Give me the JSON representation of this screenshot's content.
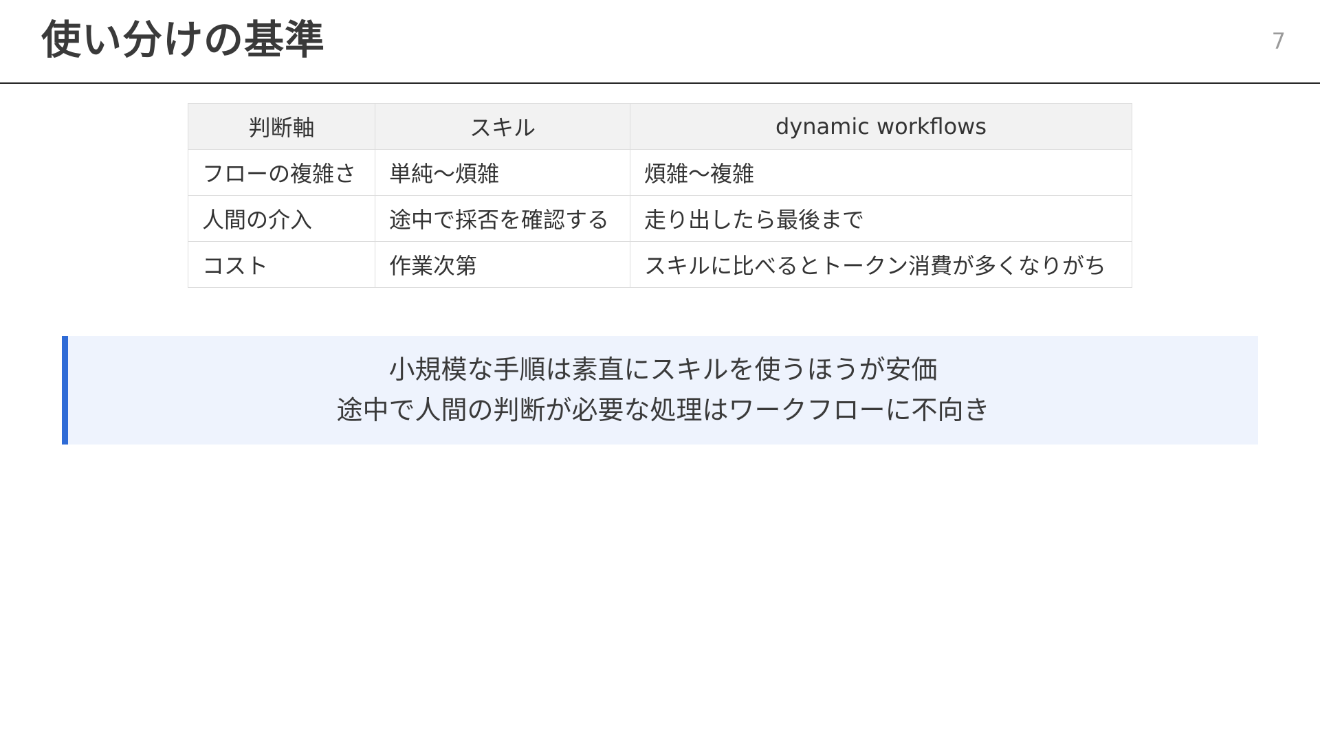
{
  "slide": {
    "title": "使い分けの基準",
    "page_number": "7"
  },
  "table": {
    "headers": [
      "判断軸",
      "スキル",
      "dynamic workflows"
    ],
    "rows": [
      [
        "フローの複雑さ",
        "単純〜煩雑",
        "煩雑〜複雑"
      ],
      [
        "人間の介入",
        "途中で採否を確認する",
        "走り出したら最後まで"
      ],
      [
        "コスト",
        "作業次第",
        "スキルに比べるとトークン消費が多くなりがち"
      ]
    ]
  },
  "callout": {
    "lines": [
      "小規模な手順は素直にスキルを使うほうが安価",
      "途中で人間の判断が必要な処理はワークフローに不向き"
    ],
    "accent_color": "#2f6bd6",
    "background_color": "#eef3fd"
  }
}
